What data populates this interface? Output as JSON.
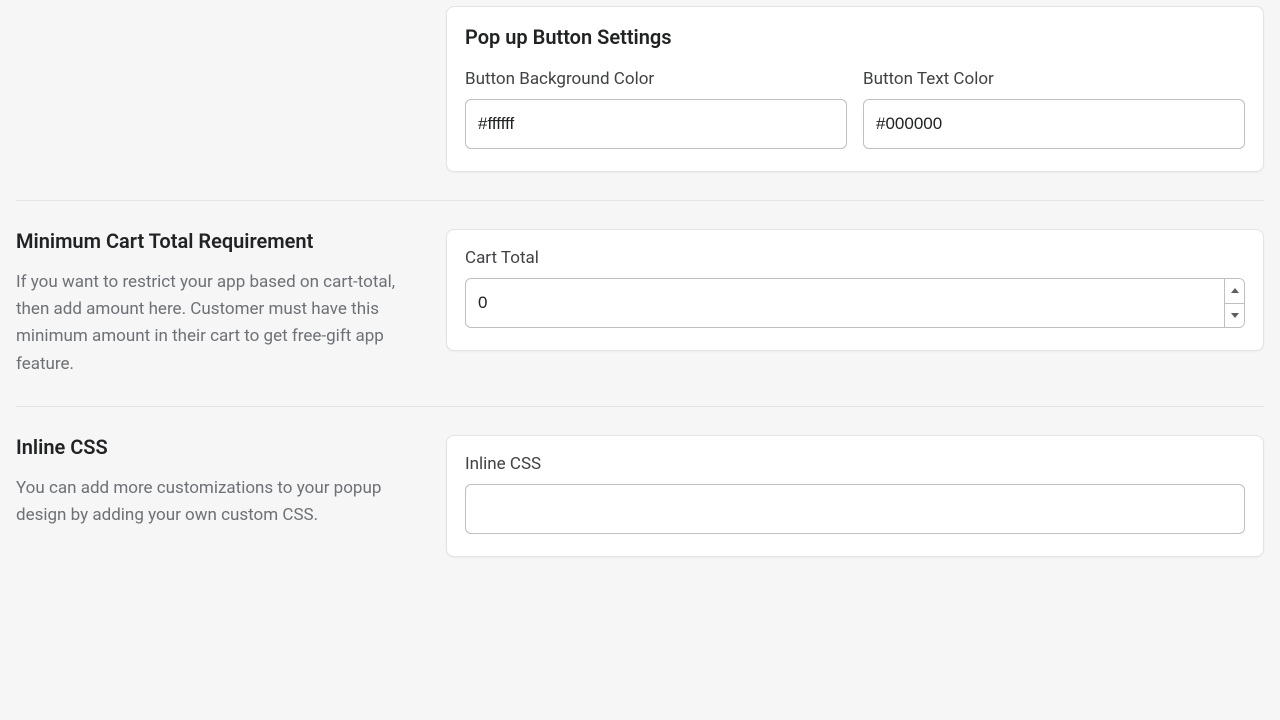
{
  "popup": {
    "title": "Pop up Button Settings",
    "bg_label": "Button Background Color",
    "bg_value": "#ffffff",
    "text_label": "Button Text Color",
    "text_value": "#000000"
  },
  "cart": {
    "title": "Minimum Cart Total Requirement",
    "desc": "If you want to restrict your app based on cart-total, then add amount here. Customer must have this minimum amount in their cart to get free-gift app feature.",
    "field_label": "Cart Total",
    "value": "0"
  },
  "css": {
    "title": "Inline CSS",
    "desc": "You can add more customizations to your popup design by adding your own custom CSS.",
    "field_label": "Inline CSS",
    "value": ""
  }
}
